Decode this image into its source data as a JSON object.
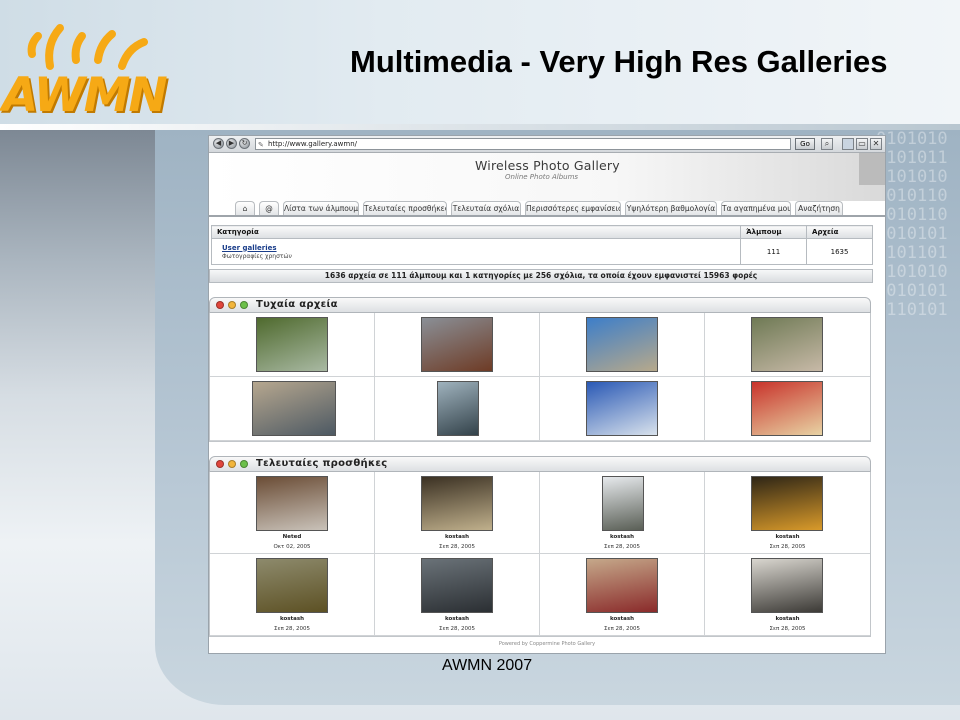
{
  "slide": {
    "title": "Multimedia - Very High Res Galleries",
    "footer": "AWMN 2007",
    "logo_text": "AWMN",
    "binary_pattern": "01010100101011010101010101101010110101010101011010101010101010101101010101101010101010",
    "accent_color": "#f6a915"
  },
  "browser": {
    "url": "http://www.gallery.awmn/",
    "go_label": "Go",
    "gallery_title": "Wireless Photo Gallery",
    "gallery_subtitle": "Online Photo Albums",
    "tabs": [
      {
        "label": "@"
      },
      {
        "label": "Λίστα των άλμπουμ"
      },
      {
        "label": "Τελευταίες προσθήκες"
      },
      {
        "label": "Τελευταία σχόλια"
      },
      {
        "label": "Περισσότερες εμφανίσεις"
      },
      {
        "label": "Υψηλότερη βαθμολογία"
      },
      {
        "label": "Τα αγαπημένα μου"
      },
      {
        "label": "Αναζήτηση"
      }
    ],
    "categories": {
      "headers": [
        "Κατηγορία",
        "Άλμπουμ",
        "Αρχεία"
      ],
      "rows": [
        {
          "name": "User galleries",
          "desc": "Φωτογραφίες χρηστών",
          "albums": "111",
          "files": "1635"
        }
      ]
    },
    "stats": "1636 αρχεία σε 111 άλμπουμ και 1 κατηγορίες με 256 σχόλια, τα οποία έχουν εμφανιστεί 15963 φορές",
    "random_block": {
      "title": "Τυχαία αρχεία",
      "thumbs": [
        {
          "icon": "park-photo-icon",
          "colors": [
            "#4f6a2e",
            "#a9b9a3"
          ]
        },
        {
          "icon": "cliff-photo-icon",
          "colors": [
            "#8a8f96",
            "#6e3b25"
          ]
        },
        {
          "icon": "coast-photo-icon",
          "colors": [
            "#3d7ec9",
            "#b7a98b"
          ]
        },
        {
          "icon": "people-photo-icon",
          "colors": [
            "#6f7a55",
            "#c7b9a7"
          ]
        },
        {
          "icon": "fountain-photo-icon",
          "colors": [
            "#b6a78f",
            "#4d5963"
          ]
        },
        {
          "icon": "building-photo-icon",
          "colors": [
            "#9fb2bd",
            "#33424a"
          ]
        },
        {
          "icon": "bridge-photo-icon",
          "colors": [
            "#2a59b5",
            "#d9e2ec"
          ]
        },
        {
          "icon": "food-photo-icon",
          "colors": [
            "#c8332b",
            "#e8d3a4"
          ]
        }
      ]
    },
    "latest_block": {
      "title": "Τελευταίες προσθήκες",
      "items": [
        {
          "icon": "cage-photo-icon",
          "name": "Neted",
          "date": "Οκτ 02, 2005",
          "colors": [
            "#6b4d36",
            "#c9c2b9"
          ]
        },
        {
          "icon": "mall-photo-icon",
          "name": "kostash",
          "date": "Σεπ 28, 2005",
          "colors": [
            "#3b3123",
            "#c0b08c"
          ]
        },
        {
          "icon": "statue-photo-icon",
          "name": "kostash",
          "date": "Σεπ 28, 2005",
          "colors": [
            "#e6e9ec",
            "#5a5f56"
          ]
        },
        {
          "icon": "pagoda-photo-icon",
          "name": "kostash",
          "date": "Σεπ 28, 2005",
          "colors": [
            "#2f2616",
            "#d99a2a"
          ]
        },
        {
          "icon": "plate-photo-icon",
          "name": "kostash",
          "date": "Σεπ 28, 2005",
          "colors": [
            "#8d8a6c",
            "#5d5124"
          ]
        },
        {
          "icon": "cityscape-photo-icon",
          "name": "kostash",
          "date": "Σεπ 28, 2005",
          "colors": [
            "#6a7278",
            "#2b2f33"
          ]
        },
        {
          "icon": "group-photo-icon",
          "name": "kostash",
          "date": "Σεπ 28, 2005",
          "colors": [
            "#c5a88a",
            "#8a2a2a"
          ]
        },
        {
          "icon": "interior-photo-icon",
          "name": "kostash",
          "date": "Σεπ 28, 2005",
          "colors": [
            "#d9d6cf",
            "#3c3a36"
          ]
        }
      ]
    },
    "powered_by": "Powered by Coppermine Photo Gallery"
  }
}
